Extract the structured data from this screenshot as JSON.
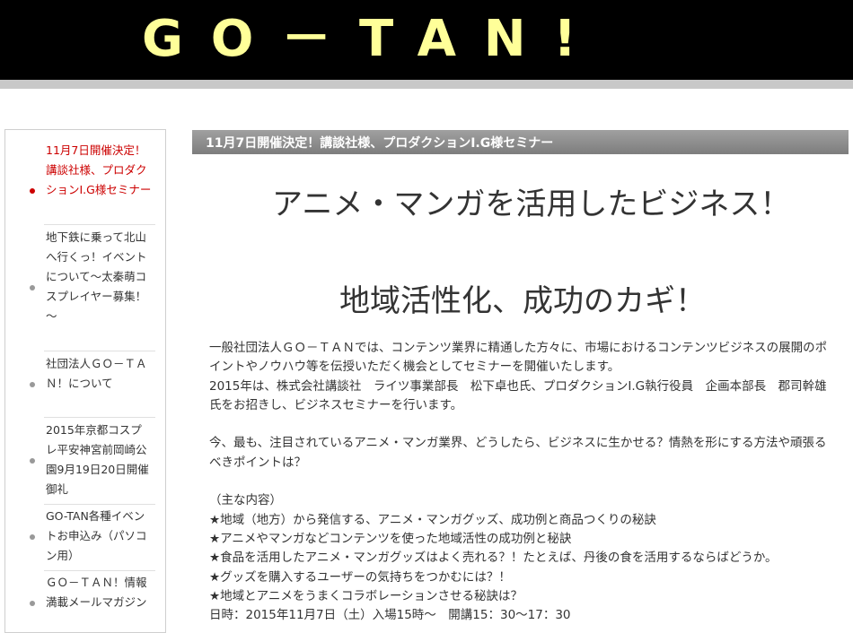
{
  "header": {
    "title": "GO－TAN!"
  },
  "sidebar": {
    "items": [
      {
        "label": "11月7日開催決定！講談社様、プロダクションI.G様セミナー",
        "active": true
      },
      {
        "label": "地下鉄に乗って北山へ行くっ！イベントについて～太秦萌コスプレイヤー募集！～",
        "active": false
      },
      {
        "label": "社団法人ＧＯ－ＴＡＮ！について",
        "active": false
      },
      {
        "label": "2015年京都コスプレ平安神宮前岡崎公園9月19日20日開催御礼",
        "active": false
      },
      {
        "label": "GO-TAN各種イベントお申込み（パソコン用）",
        "active": false
      },
      {
        "label": "ＧＯ－ＴＡＮ！情報満載メールマガジン",
        "active": false
      }
    ]
  },
  "main": {
    "title_bar": "11月7日開催決定！講談社様、プロダクションI.G様セミナー",
    "heading1": "アニメ・マンガを活用したビジネス！",
    "heading2": "地域活性化、成功のカギ！",
    "paragraphs": [
      "一般社団法人ＧＯ－ＴＡＮでは、コンテンツ業界に精通した方々に、市場におけるコンテンツビジネスの展開のポイントやノウハウ等を伝授いただく機会としてセミナーを開催いたします。",
      "2015年は、株式会社講談社　ライツ事業部長　松下卓也氏、プロダクションI.G執行役員　企画本部長　郡司幹雄氏をお招きし、ビジネスセミナーを行います。",
      "",
      "今、最も、注目されているアニメ・マンガ業界、どうしたら、ビジネスに生かせる？情熱を形にする方法や頑張るべきポイントは？",
      "",
      "（主な内容）",
      "★地域（地方）から発信する、アニメ・マンガグッズ、成功例と商品つくりの秘訣",
      "★アニメやマンガなどコンテンツを使った地域活性の成功例と秘訣",
      "★食品を活用したアニメ・マンガグッズはよく売れる？！たとえば、丹後の食を活用するならばどうか。",
      "★グッズを購入するユーザーの気持ちをつかむには？！",
      "★地域とアニメをうまくコラボレーションさせる秘訣は？",
      "日時：2015年11月7日（土）入場15時～　開講15：30～17：30"
    ]
  }
}
